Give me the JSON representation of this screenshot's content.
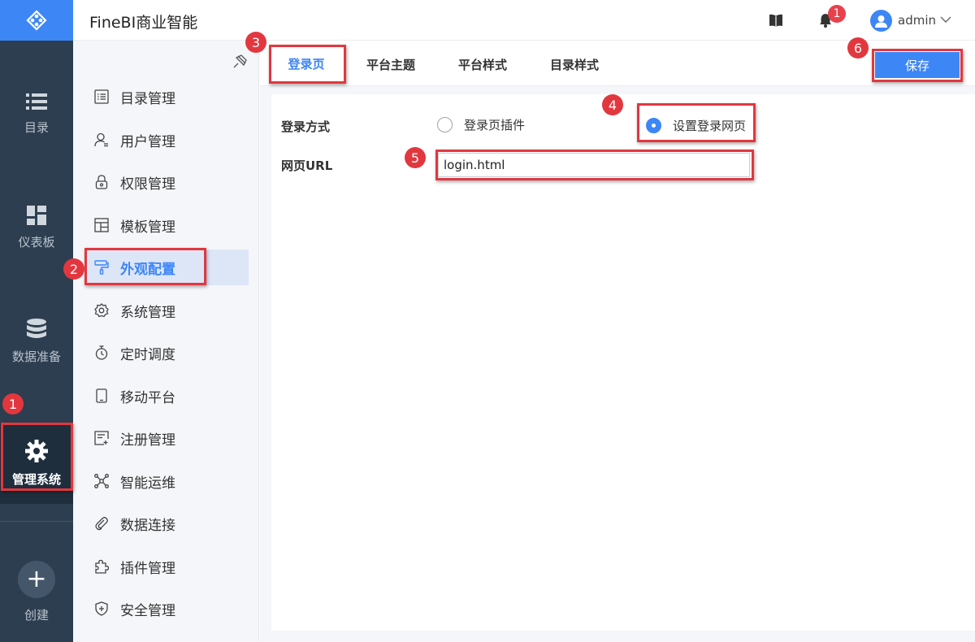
{
  "app": {
    "title": "FineBI商业智能"
  },
  "header": {
    "notification_count": "1",
    "user_name": "admin"
  },
  "rail": {
    "items": [
      {
        "label": "目录",
        "icon": "list-icon"
      },
      {
        "label": "仪表板",
        "icon": "dashboard-icon"
      },
      {
        "label": "数据准备",
        "icon": "database-icon"
      },
      {
        "label": "管理系统",
        "icon": "gear-icon",
        "active": true
      }
    ],
    "create_label": "创建"
  },
  "menu": {
    "items": [
      {
        "label": "目录管理",
        "icon": "catalog-icon"
      },
      {
        "label": "用户管理",
        "icon": "user-icon"
      },
      {
        "label": "权限管理",
        "icon": "lock-icon"
      },
      {
        "label": "模板管理",
        "icon": "template-icon"
      },
      {
        "label": "外观配置",
        "icon": "paint-roller-icon",
        "active": true
      },
      {
        "label": "系统管理",
        "icon": "settings-icon"
      },
      {
        "label": "定时调度",
        "icon": "timer-icon"
      },
      {
        "label": "移动平台",
        "icon": "mobile-icon"
      },
      {
        "label": "注册管理",
        "icon": "register-icon"
      },
      {
        "label": "智能运维",
        "icon": "network-icon"
      },
      {
        "label": "数据连接",
        "icon": "paperclip-icon"
      },
      {
        "label": "插件管理",
        "icon": "puzzle-icon"
      },
      {
        "label": "安全管理",
        "icon": "shield-icon"
      }
    ]
  },
  "tabs": [
    {
      "label": "登录页",
      "active": true
    },
    {
      "label": "平台主题"
    },
    {
      "label": "平台样式"
    },
    {
      "label": "目录样式"
    }
  ],
  "toolbar": {
    "save_label": "保存"
  },
  "form": {
    "login_method_label": "登录方式",
    "option_plugin": "登录页插件",
    "option_custom": "设置登录网页",
    "selected_option": "设置登录网页",
    "url_label": "网页URL",
    "url_value": "login.html"
  },
  "annotations": [
    "1",
    "2",
    "3",
    "4",
    "5",
    "6"
  ],
  "colors": {
    "accent": "#3d86f5",
    "rail_bg": "#2d3e50",
    "highlight": "#e2373f"
  }
}
